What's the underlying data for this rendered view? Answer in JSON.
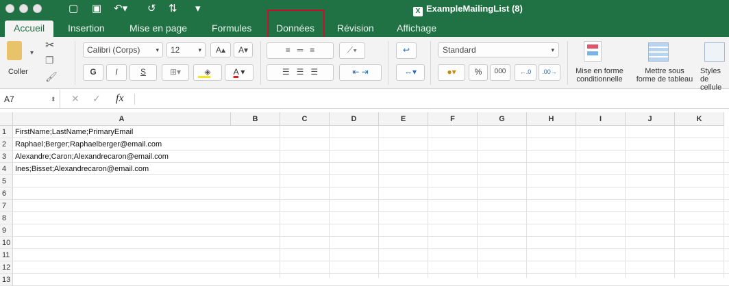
{
  "window": {
    "title": "ExampleMailingList (8)"
  },
  "tabs": [
    "Accueil",
    "Insertion",
    "Mise en page",
    "Formules",
    "Données",
    "Révision",
    "Affichage"
  ],
  "active_tab": "Accueil",
  "ribbon": {
    "paste_label": "Coller",
    "font_name": "Calibri (Corps)",
    "font_size": "12",
    "bold": "G",
    "italic": "I",
    "underline": "S",
    "number_format": "Standard",
    "percent": "%",
    "thousands": "000",
    "cond_format": "Mise en forme\nconditionnelle",
    "format_table": "Mettre sous\nforme de tableau",
    "cell_styles": "Styles de\ncellule"
  },
  "formula_bar": {
    "name_box": "A7",
    "cancel": "✕",
    "enter": "✓",
    "fx": "fx",
    "content": ""
  },
  "grid": {
    "columns": [
      "A",
      "B",
      "C",
      "D",
      "E",
      "F",
      "G",
      "H",
      "I",
      "J",
      "K"
    ],
    "rows": [
      "1",
      "2",
      "3",
      "4",
      "5",
      "6",
      "7",
      "8",
      "9",
      "10",
      "11",
      "12",
      "13"
    ],
    "cells": [
      "FirstName;LastName;PrimaryEmail",
      "Raphael;Berger;Raphaelberger@email.com",
      "Alexandre;Caron;Alexandrecaron@email.com",
      "Ines;Bisset;Alexandrecaron@email.com"
    ]
  }
}
